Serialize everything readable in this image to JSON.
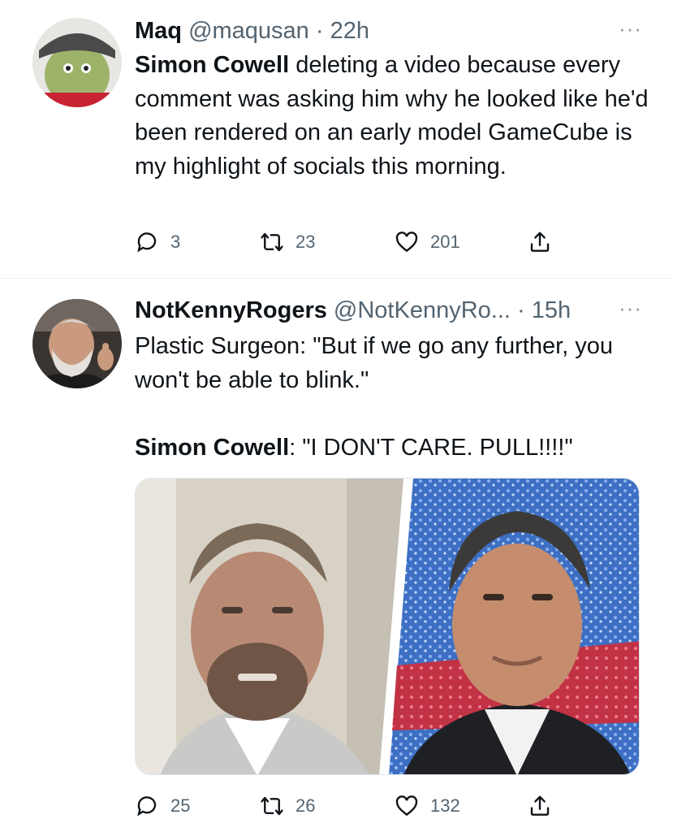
{
  "tweets": [
    {
      "name": "Maq",
      "handle": "@maqusan",
      "time": "22h",
      "separator": "·",
      "more_label": "···",
      "text_strong": "Simon Cowell",
      "text_rest": " deleting a video because every comment was asking him why he looked like he'd been rendered on an early model GameCube is my highlight of socials this morning.",
      "stats": {
        "replies": "3",
        "retweets": "23",
        "likes": "201"
      }
    },
    {
      "name": "NotKennyRogers",
      "handle": "@NotKennyRo...",
      "time": "15h",
      "separator": "·",
      "more_label": "···",
      "line1": "Plastic Surgeon: \"But if we go any further, you won't be able to blink.\"",
      "line2_strong": "Simon Cowell",
      "line2_rest": ": \"I DON'T CARE. PULL!!!!\"",
      "stats": {
        "replies": "25",
        "retweets": "26",
        "likes": "132"
      }
    }
  ],
  "icons": {
    "reply": "reply-icon",
    "retweet": "retweet-icon",
    "like": "heart-icon",
    "share": "share-icon"
  },
  "colors": {
    "text": "#0f1419",
    "secondary": "#536471",
    "divider": "#eff3f4"
  }
}
